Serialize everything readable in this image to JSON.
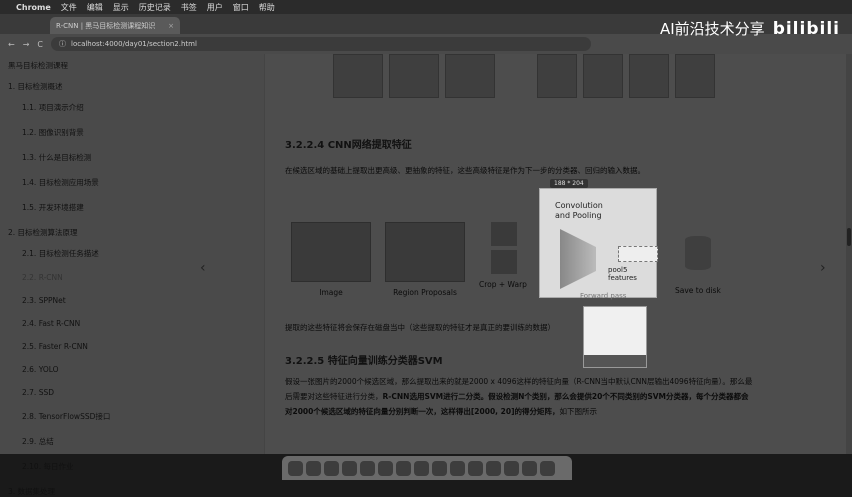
{
  "menubar": {
    "apple": "",
    "items": [
      "Chrome",
      "文件",
      "编辑",
      "显示",
      "历史记录",
      "书签",
      "用户",
      "窗口",
      "帮助"
    ]
  },
  "tab": {
    "title": "R-CNN | 黑马目标检测课程知识",
    "close": "×"
  },
  "address": {
    "url": "localhost:4000/day01/section2.html",
    "back": "←",
    "forward": "→",
    "reload": "C"
  },
  "watermark": {
    "text": "AI前沿技术分享",
    "brand": "bilibili"
  },
  "sidebar": {
    "course": "黑马目标检测课程",
    "sections": [
      {
        "label": "1. 目标检测概述",
        "items": [
          "1.1. 项目演示介绍",
          "1.2. 图像识别背景",
          "1.3. 什么是目标检测",
          "1.4. 目标检测应用场景",
          "1.5. 开发环境搭建"
        ]
      },
      {
        "label": "2. 目标检测算法原理",
        "items": [
          "2.1. 目标检测任务描述",
          "2.2. R-CNN",
          "2.3. SPPNet",
          "2.4. Fast R-CNN",
          "2.5. Faster R-CNN",
          "2.6. YOLO",
          "2.7. SSD",
          "2.8. TensorFlowSSD接口",
          "2.9. 总结",
          "2.10. 每日作业"
        ]
      }
    ],
    "last": "3. 数据集处理"
  },
  "main": {
    "h4": "3.2.2.4 CNN网络提取特征",
    "para1": "在候选区域的基础上提取出更高级、更抽象的特征，这些高级特征是作为下一步的分类器、回归的输入数据。",
    "fig_captions": [
      "Image",
      "Region Proposals",
      "Crop + Warp",
      "Save to disk"
    ],
    "popup": {
      "size": "188 * 204",
      "conv1": "Convolution",
      "conv2": "and Pooling",
      "pool": "pool5 features",
      "fwd": "Forward pass"
    },
    "para2": "提取的这些特征将会保存在磁盘当中（这些提取的特征才是真正的要训练的数据）",
    "h5": "3.2.2.5 特征向量训练分类器SVM",
    "para3a": "假设一张图片的2000个候选区域，那么提取出来的就是2000 x 4096这样的特征向量（R-CNN当中默认CNN层输出4096特征向量）。那么最后需要对这些特征进行分类，",
    "para3b": "R-CNN选用SVM进行二分类。假设检测N个类别，那么会提供20个不同类别的SVM分类器，每个分类器都会对2000个候选区域的特征向量分别判断一次，这样得出[2000, 20]的得分矩阵，",
    "para3c": "如下图所示",
    "arrow_left": "‹",
    "arrow_right": "›"
  }
}
